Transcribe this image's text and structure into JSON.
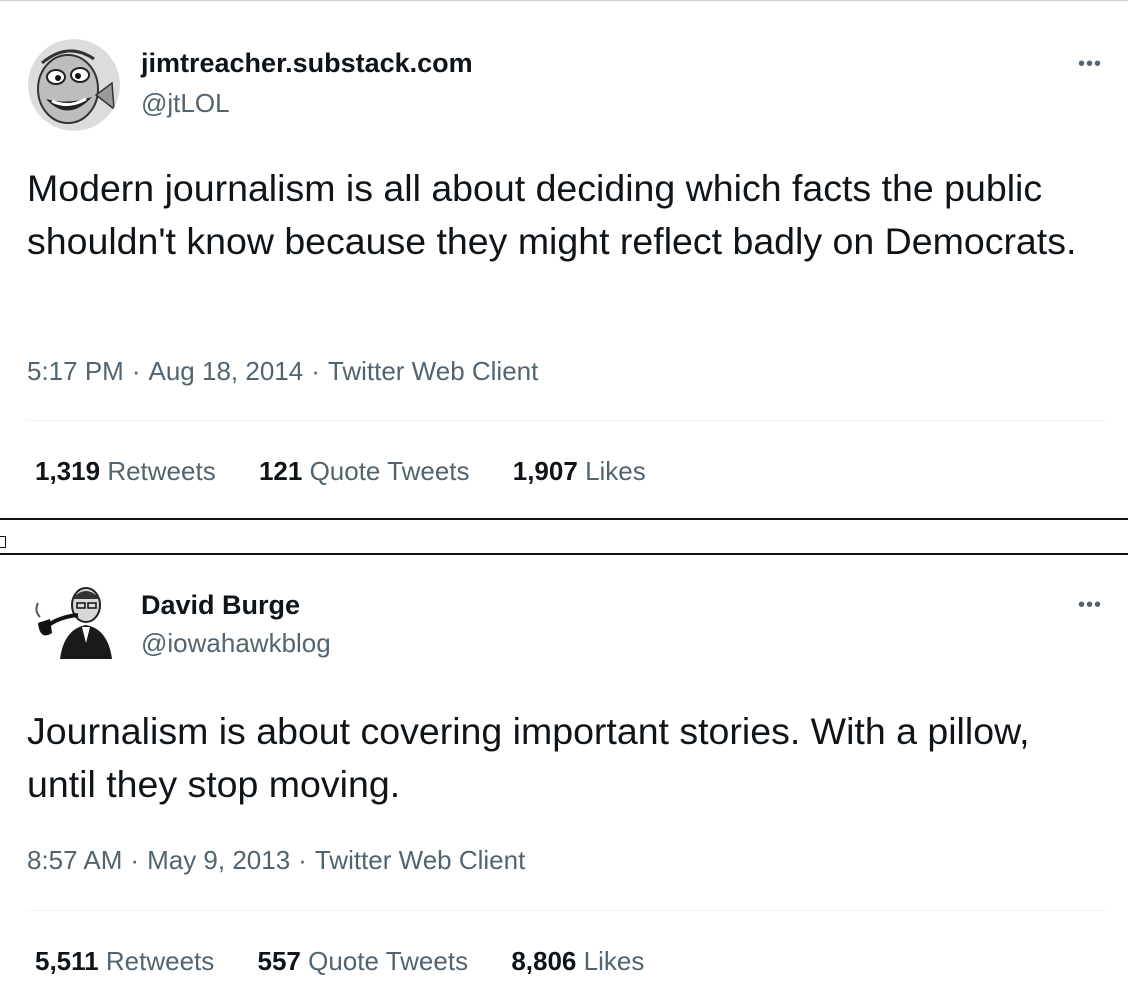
{
  "tweets": [
    {
      "display_name": "jimtreacher.substack.com",
      "handle": "@jtLOL",
      "more_label": "•••",
      "avatar_icon": "cartoon-face-avatar",
      "text": "Modern journalism is all about deciding which facts the public shouldn't know because they might reflect badly on Democrats.",
      "time": "5:17 PM",
      "date": "Aug 18, 2014",
      "client": "Twitter Web Client",
      "retweets": {
        "count": "1,319",
        "label": "Retweets"
      },
      "quotes": {
        "count": "121",
        "label": "Quote Tweets"
      },
      "likes": {
        "count": "1,907",
        "label": "Likes"
      }
    },
    {
      "display_name": "David Burge",
      "handle": "@iowahawkblog",
      "more_label": "•••",
      "avatar_icon": "man-with-pipe-avatar",
      "text": "Journalism is about covering important stories. With a pillow, until they stop moving.",
      "time": "8:57 AM",
      "date": "May 9, 2013",
      "client": "Twitter Web Client",
      "retweets": {
        "count": "5,511",
        "label": "Retweets"
      },
      "quotes": {
        "count": "557",
        "label": "Quote Tweets"
      },
      "likes": {
        "count": "8,806",
        "label": "Likes"
      }
    }
  ],
  "colors": {
    "text": "#0f1419",
    "secondary": "#536471",
    "divider": "#eff3f4"
  }
}
